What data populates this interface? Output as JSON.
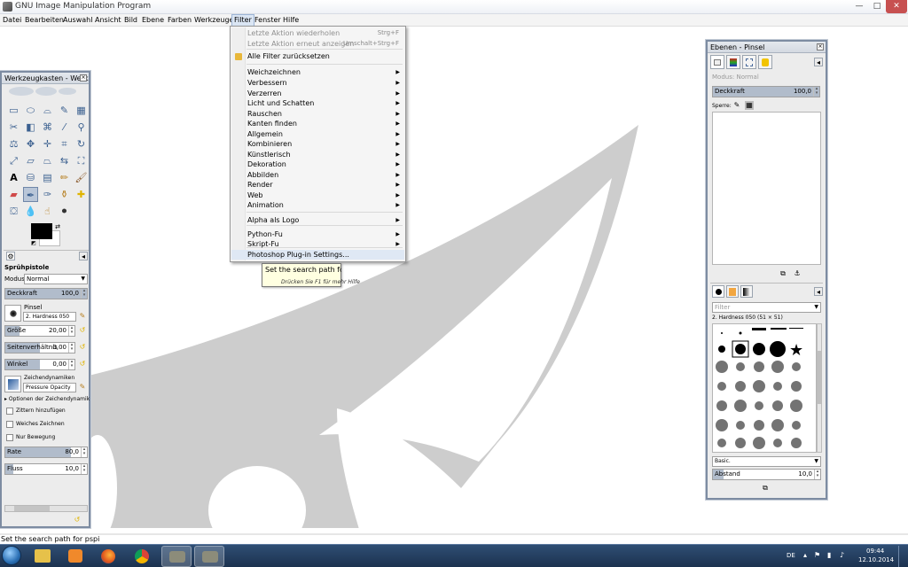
{
  "window": {
    "title": "GNU Image Manipulation Program"
  },
  "window_controls": {
    "minimize": "—",
    "maximize": "□",
    "close": "✕"
  },
  "menubar": [
    "Datei",
    "Bearbeiten",
    "Auswahl",
    "Ansicht",
    "Bild",
    "Ebene",
    "Farben",
    "Werkzeuge",
    "Filter",
    "Fenster",
    "Hilfe"
  ],
  "filter_menu": {
    "items": [
      {
        "label": "Letzte Aktion wiederholen",
        "shortcut": "Strg+F",
        "disabled": true
      },
      {
        "label": "Letzte Aktion erneut anzeigen",
        "shortcut": "Umschalt+Strg+F",
        "disabled": true
      },
      {
        "label": "Alle Filter zurücksetzen",
        "icon": "reset-filters-icon"
      },
      {
        "label": "Weichzeichnen",
        "submenu": true
      },
      {
        "label": "Verbessern",
        "submenu": true
      },
      {
        "label": "Verzerren",
        "submenu": true
      },
      {
        "label": "Licht und Schatten",
        "submenu": true
      },
      {
        "label": "Rauschen",
        "submenu": true
      },
      {
        "label": "Kanten finden",
        "submenu": true
      },
      {
        "label": "Allgemein",
        "submenu": true
      },
      {
        "label": "Kombinieren",
        "submenu": true
      },
      {
        "label": "Künstlerisch",
        "submenu": true
      },
      {
        "label": "Dekoration",
        "submenu": true
      },
      {
        "label": "Abbilden",
        "submenu": true
      },
      {
        "label": "Render",
        "submenu": true
      },
      {
        "label": "Web",
        "submenu": true
      },
      {
        "label": "Animation",
        "submenu": true
      },
      {
        "label": "Alpha als Logo",
        "submenu": true
      },
      {
        "label": "Python-Fu",
        "submenu": true
      },
      {
        "label": "Skript-Fu",
        "submenu": true
      },
      {
        "label": "Photoshop Plug-in Settings...",
        "highlighted": true
      }
    ]
  },
  "tooltip": {
    "text": "Set the search path for pspi",
    "hint": "Drücken Sie F1 für mehr Hilfe"
  },
  "toolbox": {
    "title": "Werkzeugkasten - Werkz...",
    "tool_name": "Sprühpistole",
    "mode_label": "Modus",
    "mode_value": "Normal",
    "opacity": {
      "label": "Deckkraft",
      "value": "100,0",
      "fraction": 1.0
    },
    "brush_label": "Pinsel",
    "brush_value": "2. Hardness 050",
    "size": {
      "label": "Größe",
      "value": "20,00",
      "fraction": 0.2
    },
    "aspect": {
      "label": "Seitenverhältnis",
      "value": "0,00",
      "fraction": 0.5
    },
    "angle": {
      "label": "Winkel",
      "value": "0,00",
      "fraction": 0.5
    },
    "dynamics_label": "Zeichendynamiken",
    "dynamics_value": "Pressure Opacity",
    "dynamics_options": "Optionen der Zeichendynamik",
    "jitter": "Zittern hinzufügen",
    "smooth": "Weiches Zeichnen",
    "incremental": "Nur Bewegung",
    "rate": {
      "label": "Rate",
      "value": "80,0",
      "fraction": 0.8
    },
    "flow": {
      "label": "Fluss",
      "value": "10,0",
      "fraction": 0.1
    }
  },
  "layers": {
    "title": "Ebenen - Pinsel",
    "mode_label": "Modus:",
    "mode_value": "Normal",
    "opacity": {
      "label": "Deckkraft",
      "value": "100,0",
      "fraction": 1.0
    },
    "lock_label": "Sperre:",
    "brushes_filter_placeholder": "Filter",
    "brush_name": "2. Hardness 050 (51 × 51)",
    "brush_set": "Basic.",
    "spacing": {
      "label": "Abstand",
      "value": "10,0",
      "fraction": 0.1
    }
  },
  "status": {
    "text": "Set the search path for pspi"
  },
  "taskbar": {
    "language": "DE",
    "time": "09:44",
    "date": "12.10.2014"
  }
}
